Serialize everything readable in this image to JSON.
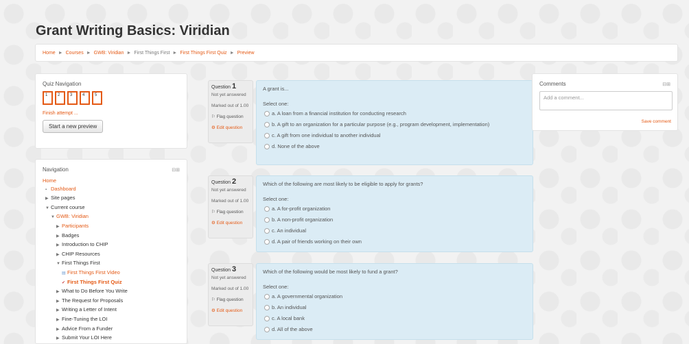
{
  "page": {
    "title": "Grant Writing Basics: Viridian"
  },
  "breadcrumb": {
    "items": [
      "Home",
      "Courses",
      "GWB: Viridian",
      "First Things First",
      "First Things First Quiz",
      "Preview"
    ],
    "separator": "►"
  },
  "quiz_nav": {
    "title": "Quiz Navigation",
    "buttons": [
      "1",
      "2",
      "3",
      "4",
      "5"
    ],
    "finish": "Finish attempt ...",
    "start_new": "Start a new preview"
  },
  "navigation": {
    "title": "Navigation",
    "dock_icons": "⊟⊞",
    "items": [
      "Home",
      "Dashboard",
      "Site pages",
      "Current course",
      "GWB: Viridian",
      "Participants",
      "Badges",
      "Introduction to CHIP",
      "CHIP Resources",
      "First Things First",
      "First Things First Video",
      "First Things First Quiz",
      "What to Do Before You Write",
      "The Request for Proposals",
      "Writing a Letter of Intent",
      "Fine-Tuning the LOI",
      "Advice From a Funder",
      "Submit Your LOI Here"
    ]
  },
  "question_info": {
    "label": "Question",
    "status": "Not yet answered",
    "marked": "Marked out of 1.00",
    "flag": "Flag question",
    "edit": "Edit question"
  },
  "questions": [
    {
      "number": "1",
      "text": "A grant is...",
      "select": "Select one:",
      "answers": [
        "a. A loan from a financial institution for conducting research",
        "b. A gift to an organization for a particular purpose (e.g., program development, implementation)",
        "c. A gift from one individual to another individual",
        "d. None of the above"
      ]
    },
    {
      "number": "2",
      "text": "Which of the following are most likely to be eligible to apply for grants?",
      "select": "Select one:",
      "answers": [
        "a. A for-profit organization",
        "b. A non-profit organization",
        "c. An individual",
        "d. A pair of friends working on their own"
      ]
    },
    {
      "number": "3",
      "text": "Which of the following would be most likely to fund a grant?",
      "select": "Select one:",
      "answers": [
        "a. A governmental organization",
        "b. An individual",
        "c. A local bank",
        "d. All of the above"
      ]
    }
  ],
  "comments": {
    "title": "Comments",
    "dock_icons": "⊟⊞",
    "placeholder": "Add a comment...",
    "save": "Save comment"
  },
  "colors": {
    "accent": "#e45914",
    "question_bg": "#dbecf5"
  }
}
